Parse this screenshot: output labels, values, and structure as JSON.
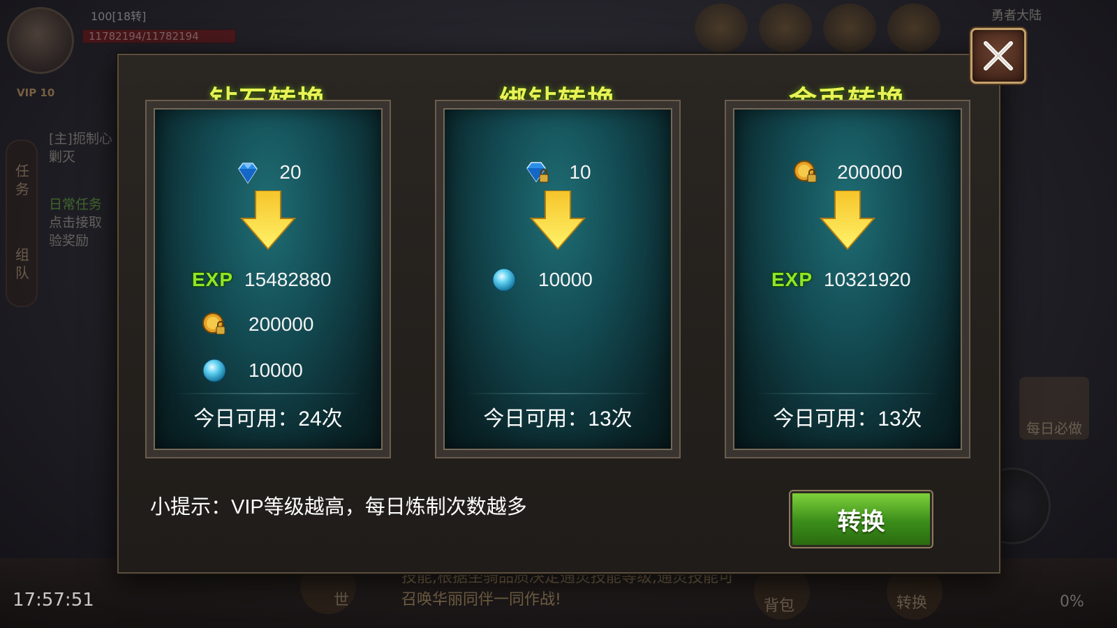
{
  "hud": {
    "player_level": "100[18转]",
    "player_hp": "11782194/11782194",
    "vip": "VIP 10",
    "side_tabs": [
      "任务",
      "组队"
    ],
    "quest_line1": "[主]扼制心",
    "quest_line2": "剿灭",
    "quest_green": "日常任务",
    "quest_line3": "点击接取",
    "quest_line4": "验奖励",
    "top_right": "勇者大陆",
    "daily": "每日必做",
    "clock": "17:57:51",
    "scroll_text": "技能,根据坐骑品质决定通灵技能等级,通灵技能可召唤华丽同伴一同作战!",
    "bottom_labels": [
      "世",
      "背包",
      "转换"
    ],
    "percent": "0%"
  },
  "modal": {
    "cards": [
      {
        "title": "钻石转换",
        "cost_icon": "diamond-icon",
        "cost": "20",
        "rewards": [
          {
            "icon": "exp-label",
            "label": "EXP",
            "value": "15482880"
          },
          {
            "icon": "bound-gold-coin-icon",
            "value": "200000"
          },
          {
            "icon": "blue-orb-icon",
            "value": "10000"
          }
        ],
        "usage": "今日可用：24次"
      },
      {
        "title": "绑钻转换",
        "cost_icon": "bound-diamond-icon",
        "cost": "10",
        "rewards": [
          {
            "icon": "blue-orb-icon",
            "value": "10000"
          }
        ],
        "usage": "今日可用：13次"
      },
      {
        "title": "金币转换",
        "cost_icon": "bound-gold-coin-icon",
        "cost": "200000",
        "rewards": [
          {
            "icon": "exp-label",
            "label": "EXP",
            "value": "10321920"
          }
        ],
        "usage": "今日可用：13次"
      }
    ],
    "tip": "小提示：VIP等级越高，每日炼制次数越多",
    "convert_button": "转换"
  },
  "colors": {
    "title": "#e8f256",
    "exp": "#8ee62a",
    "button": "#4fa524",
    "card_bg": "#134a52"
  }
}
